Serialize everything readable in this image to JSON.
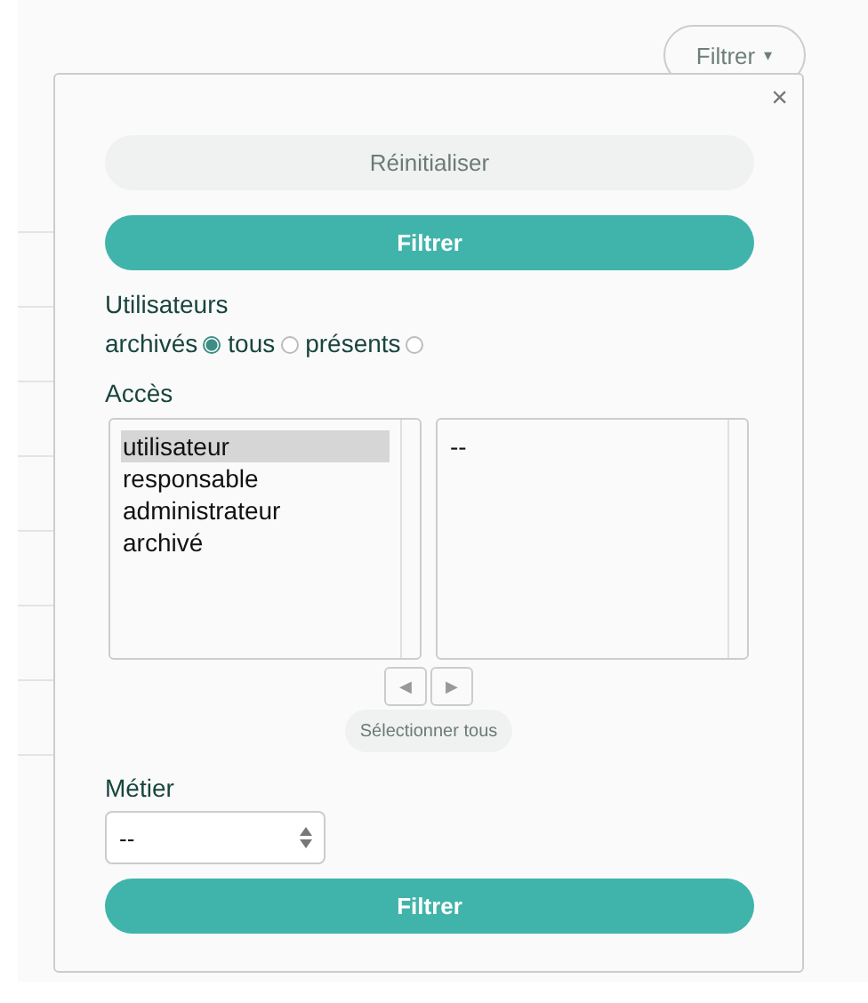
{
  "filter_toggle": {
    "label": "Filtrer",
    "caret": "▾"
  },
  "popup": {
    "close": "×",
    "reset_button": "Réinitialiser",
    "apply_button_top": "Filtrer",
    "users_label": "Utilisateurs",
    "user_options": [
      {
        "label": "archivés",
        "selected": true
      },
      {
        "label": "tous",
        "selected": false
      },
      {
        "label": "présents",
        "selected": false
      }
    ],
    "access_label": "Accès",
    "access_available": [
      {
        "label": "utilisateur",
        "selected": true
      },
      {
        "label": "responsable",
        "selected": false
      },
      {
        "label": "administrateur",
        "selected": false
      },
      {
        "label": "archivé",
        "selected": false
      }
    ],
    "access_chosen": [
      {
        "label": "--",
        "selected": false
      }
    ],
    "move_buttons": [
      {
        "symbol": "◀"
      },
      {
        "symbol": "▶"
      }
    ],
    "select_all_button": "Sélectionner tous",
    "job_label": "Métier",
    "job_select": {
      "value": "--"
    },
    "apply_button_bottom": "Filtrer"
  }
}
